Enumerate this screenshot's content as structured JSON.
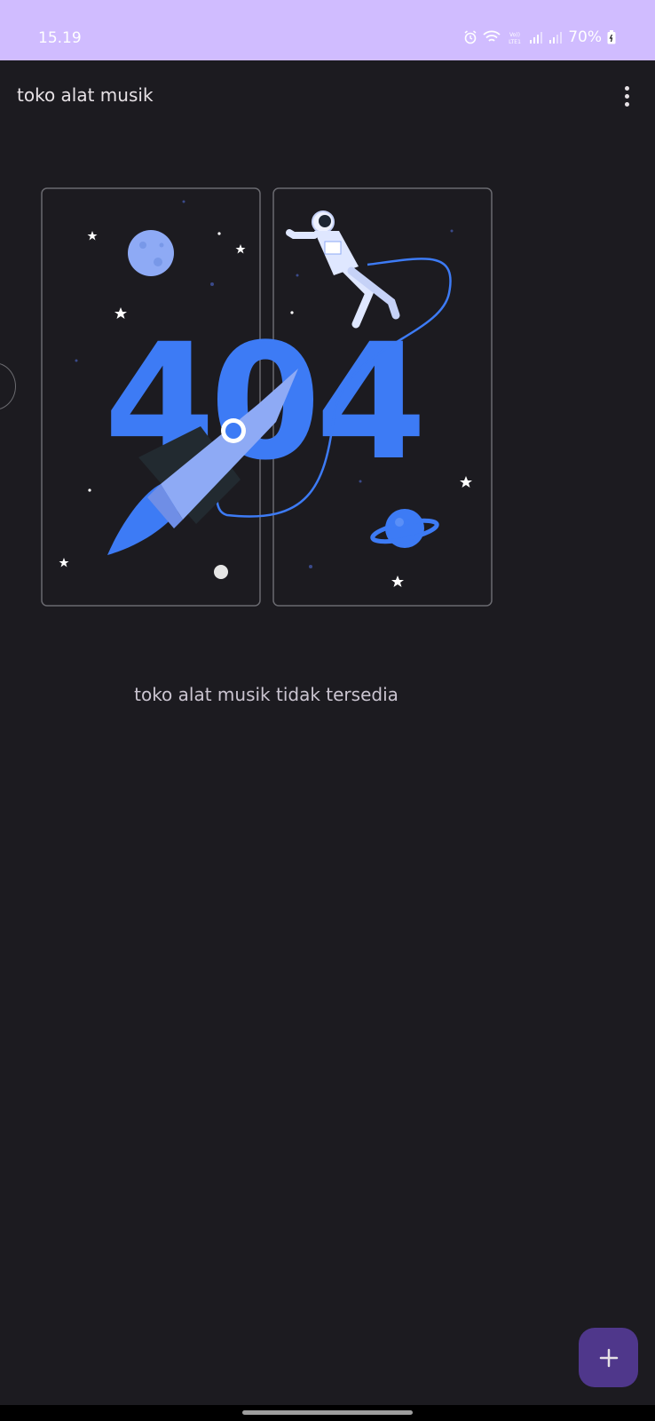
{
  "status_bar": {
    "time": "15.19",
    "battery": "70%",
    "icons": [
      "alarm-icon",
      "wifi-icon",
      "volte-icon",
      "signal-icon",
      "signal-icon",
      "battery-icon"
    ]
  },
  "app_bar": {
    "title": "toko alat musik",
    "menu_icon": "more-vert-icon"
  },
  "illustration": {
    "text_404": "404"
  },
  "empty_state": {
    "message": "toko alat musik tidak tersedia"
  },
  "fab": {
    "icon": "add-icon"
  },
  "colors": {
    "status_bar": "#d0bcff",
    "background": "#1c1b20",
    "accent_blue": "#3d7bf5",
    "fab": "#4f378b"
  }
}
